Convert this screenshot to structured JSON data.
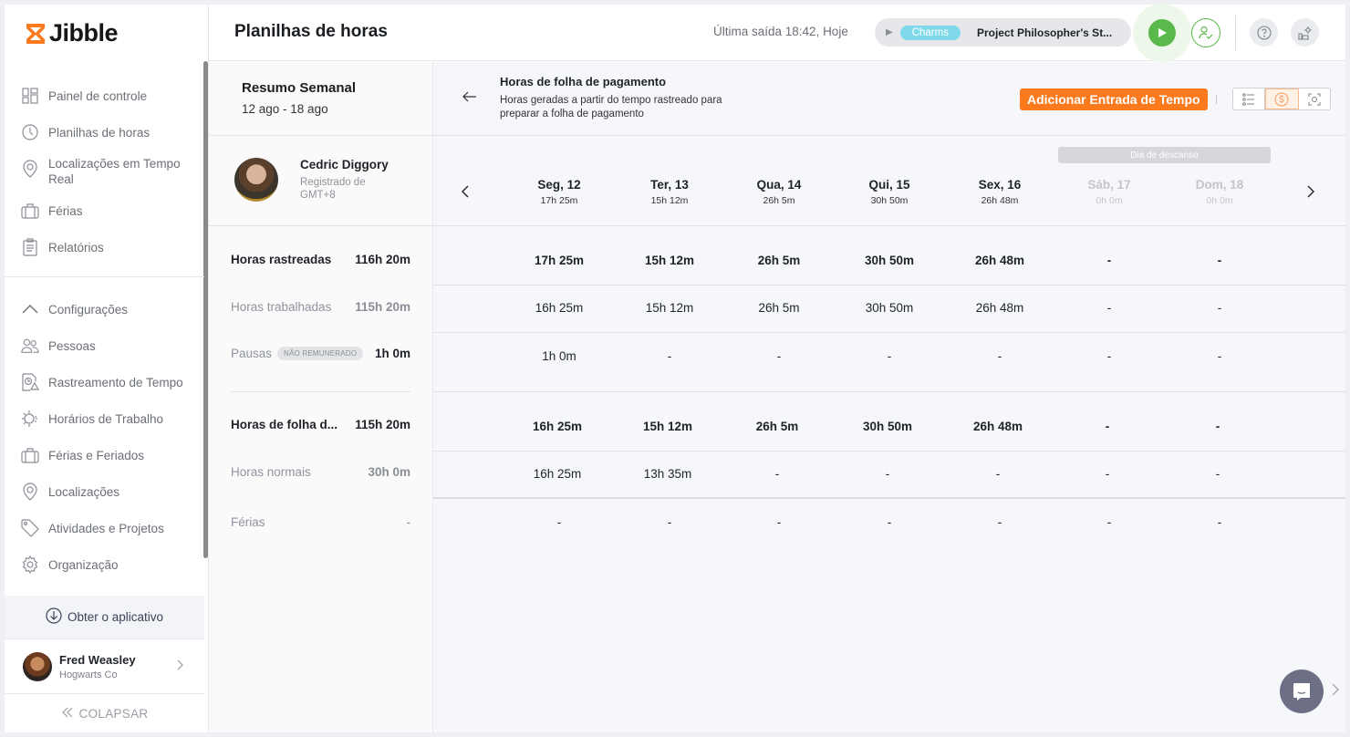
{
  "brand": {
    "name": "Jibble",
    "accent": "#fb7a1d"
  },
  "sidebar": {
    "items": [
      {
        "label": "Painel de controle",
        "icon": "dashboard-icon"
      },
      {
        "label": "Planilhas de horas",
        "icon": "clock-icon"
      },
      {
        "label": "Localizações em Tempo Real",
        "icon": "location-pin-icon"
      },
      {
        "label": "Férias",
        "icon": "suitcase-icon"
      },
      {
        "label": "Relatórios",
        "icon": "clipboard-icon"
      }
    ],
    "settings_label": "Configurações",
    "settings_items": [
      {
        "label": "Pessoas",
        "icon": "people-icon"
      },
      {
        "label": "Rastreamento de Tempo",
        "icon": "time-tracking-icon"
      },
      {
        "label": "Horários de Trabalho",
        "icon": "work-schedule-icon"
      },
      {
        "label": "Férias e Feriados",
        "icon": "suitcase-icon"
      },
      {
        "label": "Localizações",
        "icon": "location-pin-icon"
      },
      {
        "label": "Atividades e Projetos",
        "icon": "tag-icon"
      },
      {
        "label": "Organização",
        "icon": "gear-icon"
      }
    ],
    "get_app_label": "Obter o aplicativo",
    "user": {
      "name": "Fred Weasley",
      "org": "Hogwarts Co"
    },
    "collapse_label": "COLAPSAR"
  },
  "header": {
    "title": "Planilhas de horas",
    "last_out": "Última saída 18:42, Hoje",
    "timer": {
      "activity": "Charms",
      "project": "Project Philosopher's St...",
      "activity_color": "#7fd9ea"
    },
    "play_color": "#5bb84a"
  },
  "summary": {
    "title": "Resumo Semanal",
    "range": "12 ago - 18 ago",
    "person": {
      "name": "Cedric Diggory",
      "timezone": "Registrado de GMT+8"
    },
    "rows": [
      {
        "label": "Horas rastreadas",
        "value": "116h 20m"
      },
      {
        "label": "Horas trabalhadas",
        "value": "115h 20m"
      },
      {
        "label": "Pausas",
        "badge": "NÃO REMUNERADO",
        "value": "1h 0m"
      },
      {
        "label": "Horas de folha d...",
        "value": "115h 20m"
      },
      {
        "label": "Horas normais",
        "value": "30h 0m"
      },
      {
        "label": "Férias",
        "value": "-"
      }
    ]
  },
  "payroll": {
    "title": "Horas de folha de pagamento",
    "subtitle": "Horas geradas a partir do tempo rastreado para preparar a folha de pagamento",
    "add_button": "Adicionar Entrada de Tempo",
    "rest_day_label": "Dia de descanso",
    "days": [
      {
        "name": "Seg, 12",
        "total": "17h 25m",
        "off": false
      },
      {
        "name": "Ter, 13",
        "total": "15h 12m",
        "off": false
      },
      {
        "name": "Qua, 14",
        "total": "26h 5m",
        "off": false
      },
      {
        "name": "Qui, 15",
        "total": "30h 50m",
        "off": false
      },
      {
        "name": "Sex, 16",
        "total": "26h 48m",
        "off": false
      },
      {
        "name": "Sáb, 17",
        "total": "0h 0m",
        "off": true
      },
      {
        "name": "Dom, 18",
        "total": "0h 0m",
        "off": true
      }
    ],
    "rows": {
      "tracked": [
        "17h 25m",
        "15h 12m",
        "26h 5m",
        "30h 50m",
        "26h 48m",
        "-",
        "-"
      ],
      "worked": [
        "16h 25m",
        "15h 12m",
        "26h 5m",
        "30h 50m",
        "26h 48m",
        "-",
        "-"
      ],
      "breaks": [
        "1h 0m",
        "-",
        "-",
        "-",
        "-",
        "-",
        "-"
      ],
      "payroll": [
        "16h 25m",
        "15h 12m",
        "26h 5m",
        "30h 50m",
        "26h 48m",
        "-",
        "-"
      ],
      "regular": [
        "16h 25m",
        "13h 35m",
        "-",
        "-",
        "-",
        "-",
        "-"
      ],
      "vacation": [
        "-",
        "-",
        "-",
        "-",
        "-",
        "-",
        "-"
      ]
    }
  }
}
